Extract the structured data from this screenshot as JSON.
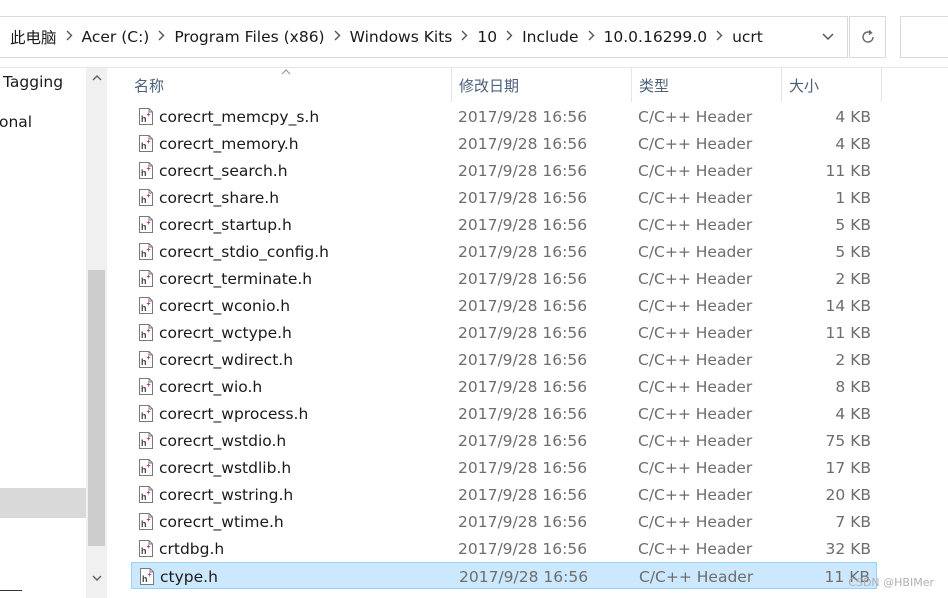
{
  "breadcrumb": [
    "此电脑",
    "Acer (C:)",
    "Program Files (x86)",
    "Windows Kits",
    "10",
    "Include",
    "10.0.16299.0",
    "ucrt"
  ],
  "nav": {
    "items": [
      "Tagging",
      "onal"
    ]
  },
  "columns": {
    "name": "名称",
    "date": "修改日期",
    "type": "类型",
    "size": "大小"
  },
  "files": [
    {
      "name": "corecrt_memcpy_s.h",
      "date": "2017/9/28 16:56",
      "type": "C/C++ Header",
      "size": "4 KB"
    },
    {
      "name": "corecrt_memory.h",
      "date": "2017/9/28 16:56",
      "type": "C/C++ Header",
      "size": "4 KB"
    },
    {
      "name": "corecrt_search.h",
      "date": "2017/9/28 16:56",
      "type": "C/C++ Header",
      "size": "11 KB"
    },
    {
      "name": "corecrt_share.h",
      "date": "2017/9/28 16:56",
      "type": "C/C++ Header",
      "size": "1 KB"
    },
    {
      "name": "corecrt_startup.h",
      "date": "2017/9/28 16:56",
      "type": "C/C++ Header",
      "size": "5 KB"
    },
    {
      "name": "corecrt_stdio_config.h",
      "date": "2017/9/28 16:56",
      "type": "C/C++ Header",
      "size": "5 KB"
    },
    {
      "name": "corecrt_terminate.h",
      "date": "2017/9/28 16:56",
      "type": "C/C++ Header",
      "size": "2 KB"
    },
    {
      "name": "corecrt_wconio.h",
      "date": "2017/9/28 16:56",
      "type": "C/C++ Header",
      "size": "14 KB"
    },
    {
      "name": "corecrt_wctype.h",
      "date": "2017/9/28 16:56",
      "type": "C/C++ Header",
      "size": "11 KB"
    },
    {
      "name": "corecrt_wdirect.h",
      "date": "2017/9/28 16:56",
      "type": "C/C++ Header",
      "size": "2 KB"
    },
    {
      "name": "corecrt_wio.h",
      "date": "2017/9/28 16:56",
      "type": "C/C++ Header",
      "size": "8 KB"
    },
    {
      "name": "corecrt_wprocess.h",
      "date": "2017/9/28 16:56",
      "type": "C/C++ Header",
      "size": "4 KB"
    },
    {
      "name": "corecrt_wstdio.h",
      "date": "2017/9/28 16:56",
      "type": "C/C++ Header",
      "size": "75 KB"
    },
    {
      "name": "corecrt_wstdlib.h",
      "date": "2017/9/28 16:56",
      "type": "C/C++ Header",
      "size": "17 KB"
    },
    {
      "name": "corecrt_wstring.h",
      "date": "2017/9/28 16:56",
      "type": "C/C++ Header",
      "size": "20 KB"
    },
    {
      "name": "corecrt_wtime.h",
      "date": "2017/9/28 16:56",
      "type": "C/C++ Header",
      "size": "7 KB"
    },
    {
      "name": "crtdbg.h",
      "date": "2017/9/28 16:56",
      "type": "C/C++ Header",
      "size": "32 KB"
    },
    {
      "name": "ctype.h",
      "date": "2017/9/28 16:56",
      "type": "C/C++ Header",
      "size": "11 KB",
      "selected": true
    }
  ],
  "watermark": "CSDN @HBIMer",
  "icons": {
    "chevron": "chevron-right-icon",
    "dropdown": "chevron-down-icon",
    "refresh": "refresh-icon",
    "file": "cpp-header-file-icon"
  },
  "colors": {
    "selection_bg": "#cce8ff",
    "selection_border": "#99d1ff",
    "header_text": "#4c607a",
    "icon_accent": "#b0309a"
  }
}
